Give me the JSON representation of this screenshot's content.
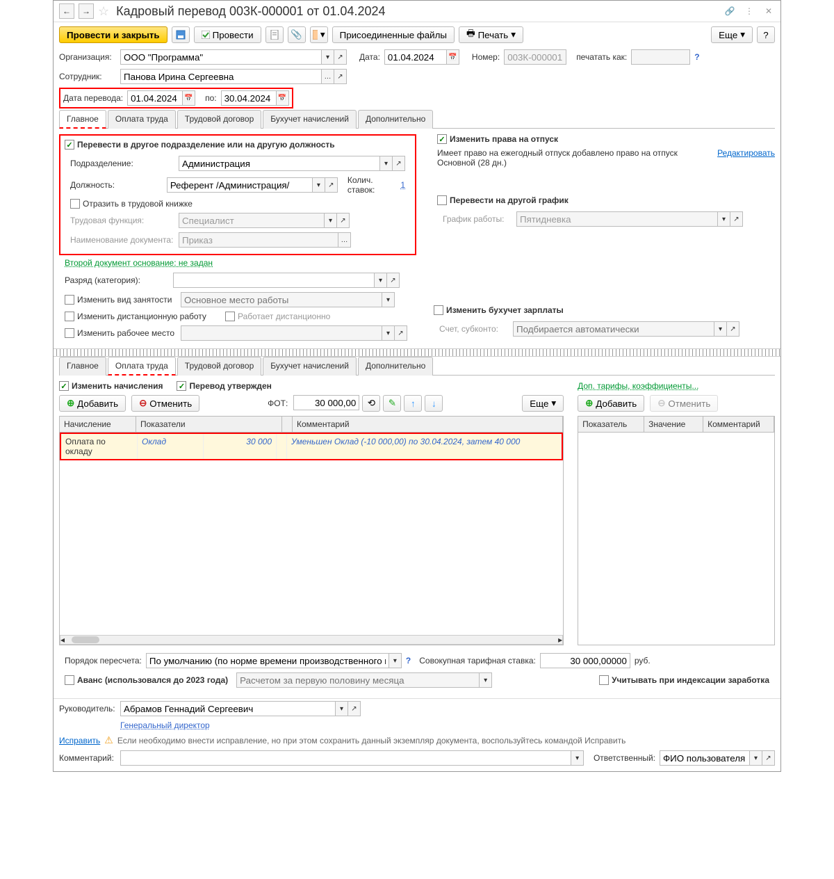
{
  "title": "Кадровый перевод 003К-000001 от 01.04.2024",
  "toolbar": {
    "post_close": "Провести и закрыть",
    "post": "Провести",
    "attached": "Присоединенные файлы",
    "print": "Печать",
    "more": "Еще"
  },
  "header": {
    "org_label": "Организация:",
    "org_value": "ООО \"Программа\"",
    "date_label": "Дата:",
    "date_value": "01.04.2024",
    "number_label": "Номер:",
    "number_value": "003К-000001",
    "print_as_label": "печатать как:",
    "employee_label": "Сотрудник:",
    "employee_value": "Панова Ирина Сергеевна",
    "transfer_date_label": "Дата перевода:",
    "transfer_date_value": "01.04.2024",
    "to_label": "по:",
    "to_value": "30.04.2024"
  },
  "tabs1": [
    "Главное",
    "Оплата труда",
    "Трудовой договор",
    "Бухучет начислений",
    "Дополнительно"
  ],
  "main_tab": {
    "transfer_checkbox": "Перевести в другое подразделение или на другую должность",
    "dept_label": "Подразделение:",
    "dept_value": "Администрация",
    "position_label": "Должность:",
    "position_value": "Референт /Администрация/",
    "rates_label": "Колич. ставок:",
    "rates_value": "1",
    "workbook_checkbox": "Отразить в трудовой книжке",
    "func_label": "Трудовая функция:",
    "func_value": "Специалист",
    "docname_label": "Наименование документа:",
    "docname_value": "Приказ",
    "second_doc_link": "Второй документ основание: не задан",
    "grade_label": "Разряд (категория):",
    "change_emp_type": "Изменить вид занятости",
    "emp_type_placeholder": "Основное место работы",
    "change_remote": "Изменить дистанционную работу",
    "remote_placeholder": "Работает дистанционно",
    "change_workplace": "Изменить рабочее место",
    "vacation_rights": "Изменить права на отпуск",
    "vacation_text": "Имеет право на ежегодный отпуск добавлено право на отпуск Основной (28 дн.)",
    "edit_link": "Редактировать",
    "change_schedule": "Перевести на другой график",
    "schedule_label": "График работы:",
    "schedule_value": "Пятидневка",
    "change_accounting": "Изменить бухучет зарплаты",
    "account_label": "Счет, субконто:",
    "account_placeholder": "Подбирается автоматически"
  },
  "tabs2": [
    "Главное",
    "Оплата труда",
    "Трудовой договор",
    "Бухучет начислений",
    "Дополнительно"
  ],
  "pay_tab": {
    "change_accruals": "Изменить начисления",
    "transfer_approved": "Перевод утвержден",
    "add": "Добавить",
    "cancel": "Отменить",
    "fot_label": "ФОТ:",
    "fot_value": "30 000,00",
    "more": "Еще",
    "extra_link": "Доп. тарифы, коэффициенты...",
    "grid_headers": [
      "Начисление",
      "Показатели",
      "",
      "Комментарий"
    ],
    "row": {
      "accrual": "Оплата по окладу",
      "indicator": "Оклад",
      "value": "30 000",
      "comment": "Уменьшен Оклад (-10 000,00) по 30.04.2024, затем 40 000"
    },
    "right_headers": [
      "Показатель",
      "Значение",
      "Комментарий"
    ],
    "recalc_label": "Порядок пересчета:",
    "recalc_value": "По умолчанию (по норме времени производственного календаря)",
    "rate_label": "Совокупная тарифная ставка:",
    "rate_value": "30 000,00000",
    "rate_currency": "руб.",
    "advance_checkbox": "Аванс (использовался до 2023 года)",
    "advance_placeholder": "Расчетом за первую половину месяца",
    "indexing_checkbox": "Учитывать при индексации заработка"
  },
  "footer": {
    "head_label": "Руководитель:",
    "head_value": "Абрамов Геннадий Сергеевич",
    "gendir_link": "Генеральный директор",
    "fix_link": "Исправить",
    "fix_text": "Если необходимо внести исправление, но при этом сохранить данный экземпляр документа, воспользуйтесь командой Исправить",
    "comment_label": "Комментарий:",
    "responsible_label": "Ответственный:",
    "responsible_value": "ФИО пользователя"
  }
}
